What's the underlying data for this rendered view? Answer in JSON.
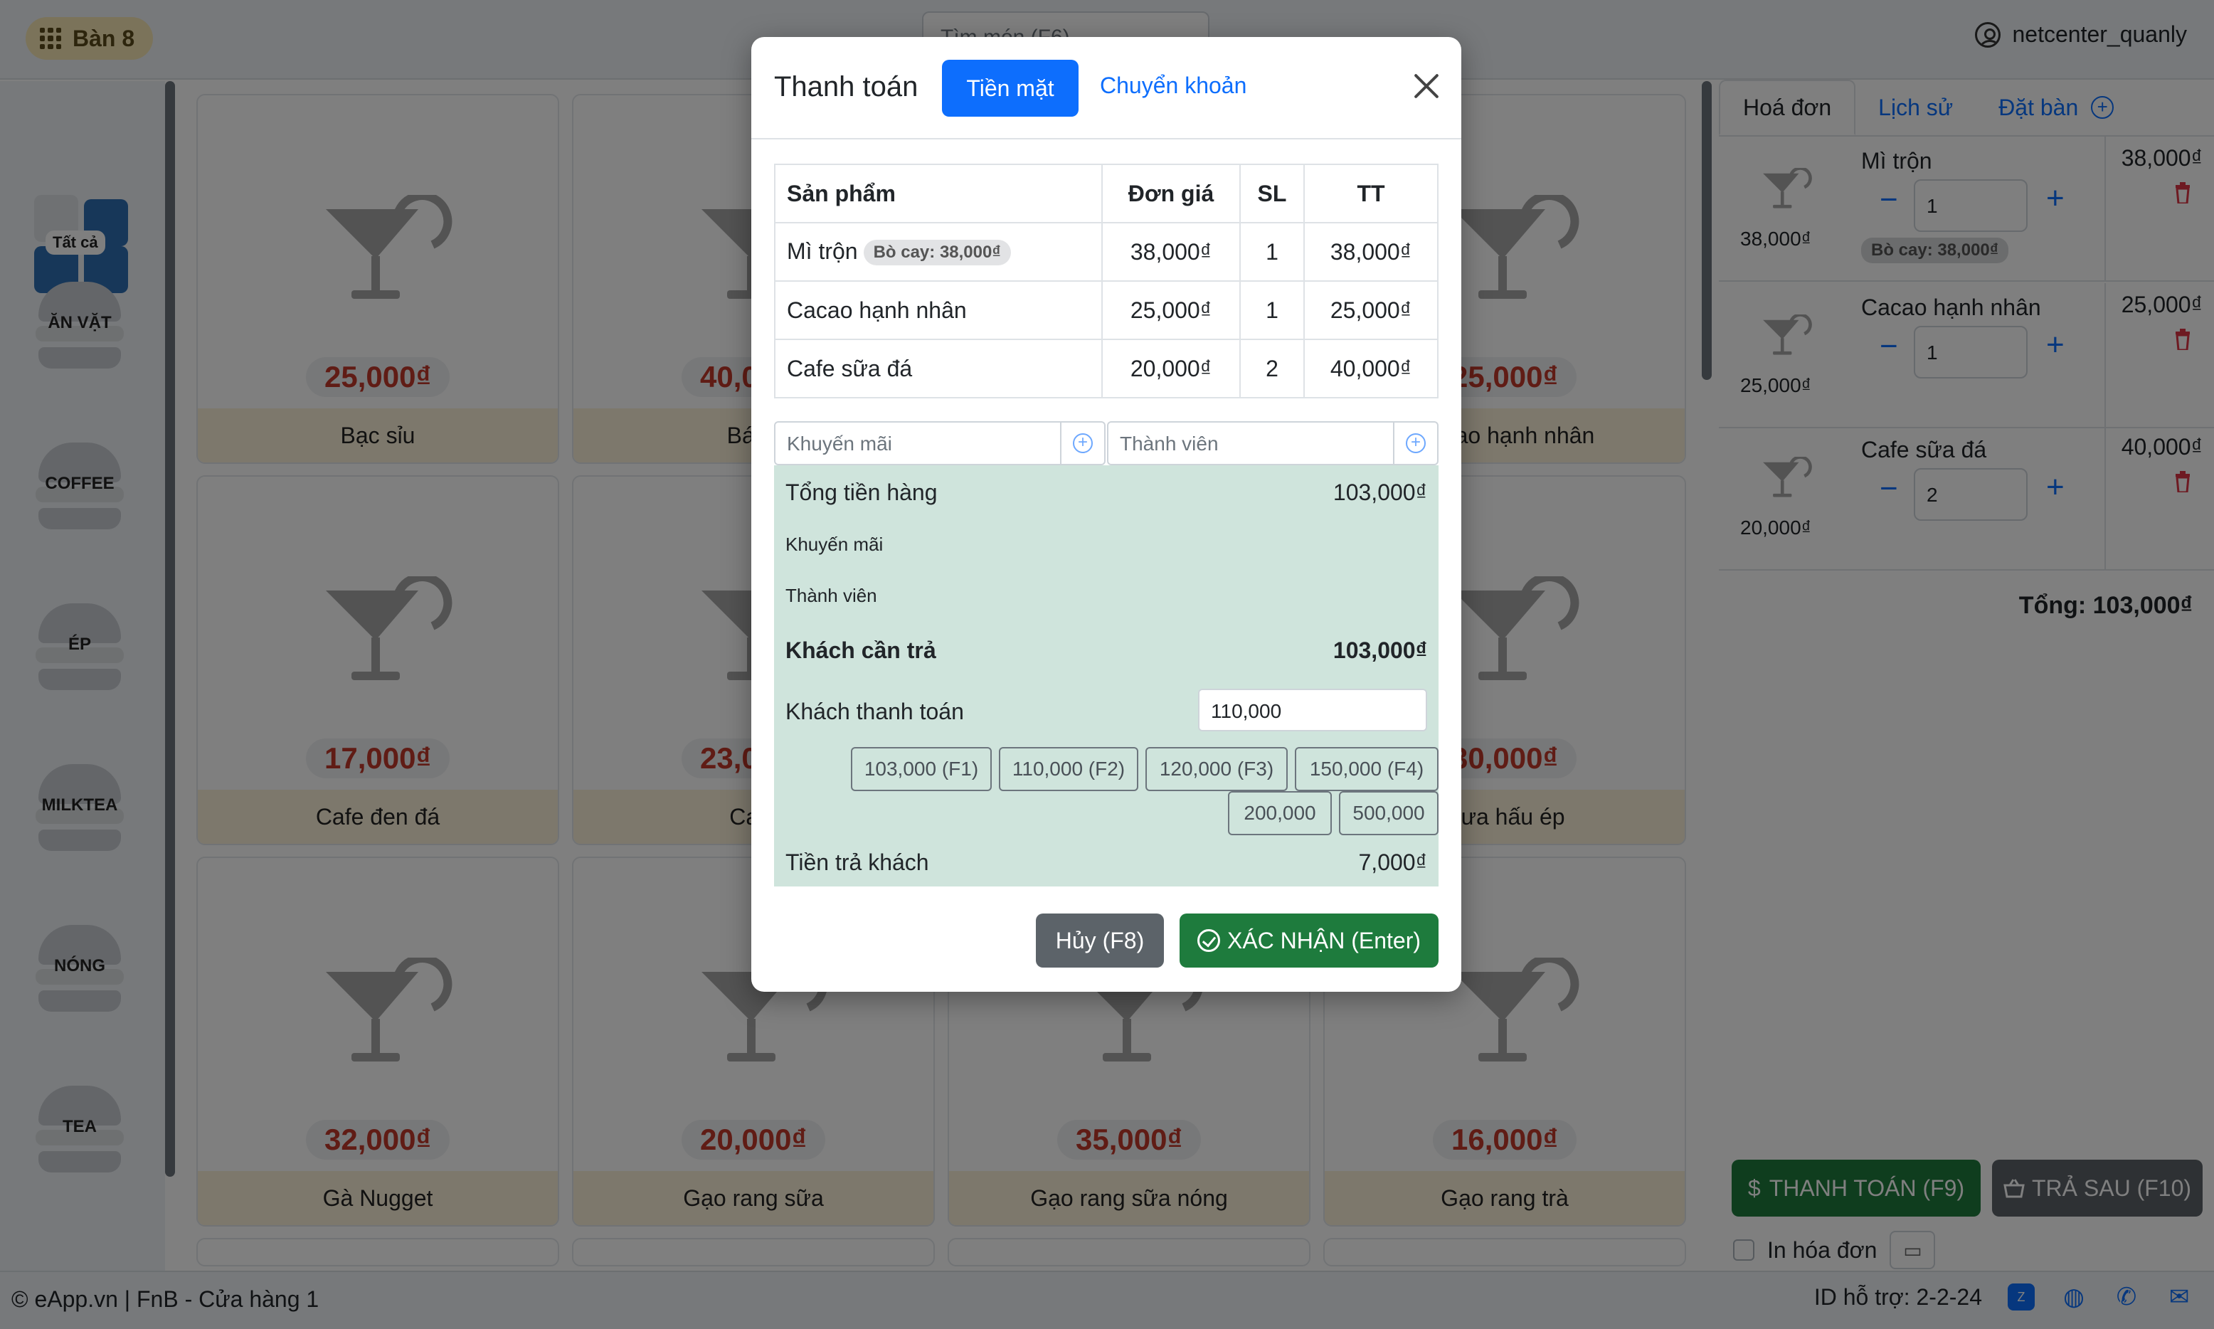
{
  "topbar": {
    "table_label": "Bàn 8",
    "search_placeholder": "Tìm món (F6)",
    "username": "netcenter_quanly"
  },
  "categories": [
    {
      "label": "Tất cả"
    },
    {
      "label": "ĂN VẶT"
    },
    {
      "label": "COFFEE"
    },
    {
      "label": "ÉP"
    },
    {
      "label": "MILKTEA"
    },
    {
      "label": "NÓNG"
    },
    {
      "label": "TEA"
    }
  ],
  "products": [
    {
      "price": "25,000₫",
      "name": "Bạc sỉu"
    },
    {
      "price": "40,000₫",
      "name": "Bánh"
    },
    {
      "price": "25,000₫",
      "name": ""
    },
    {
      "price": "25,000₫",
      "name": "Cacao hạnh nhân"
    },
    {
      "price": "17,000₫",
      "name": "Cafe đen đá"
    },
    {
      "price": "23,000₫",
      "name": "Cafe"
    },
    {
      "price": "",
      "name": ""
    },
    {
      "price": "30,000₫",
      "name": "Dưa hấu ép"
    },
    {
      "price": "32,000₫",
      "name": "Gà Nugget"
    },
    {
      "price": "20,000₫",
      "name": "Gạo rang sữa"
    },
    {
      "price": "35,000₫",
      "name": "Gạo rang sữa nóng"
    },
    {
      "price": "16,000₫",
      "name": "Gạo rang trà"
    }
  ],
  "right_panel": {
    "tabs": [
      "Hoá đơn",
      "Lịch sử",
      "Đặt bàn"
    ],
    "order_items": [
      {
        "name": "Mì trộn",
        "unit_price": "38,000₫",
        "qty": "1",
        "total": "38,000₫",
        "tag": "Bò cay: 38,000₫"
      },
      {
        "name": "Cacao hạnh nhân",
        "unit_price": "25,000₫",
        "qty": "1",
        "total": "25,000₫",
        "tag": ""
      },
      {
        "name": "Cafe sữa đá",
        "unit_price": "20,000₫",
        "qty": "2",
        "total": "40,000₫",
        "tag": ""
      }
    ],
    "total_label": "Tổng: 103,000₫",
    "pay_button": "THANH TOÁN (F9)",
    "pay_later_button": "TRẢ SAU (F10)",
    "print_label": "In hóa đơn"
  },
  "footer": {
    "left_text": "© eApp.vn | FnB - Cửa hàng 1",
    "support_id": "ID hỗ trợ: 2-2-24"
  },
  "modal": {
    "title": "Thanh toán",
    "tab_cash": "Tiền mặt",
    "tab_transfer": "Chuyển khoản",
    "table_headers": [
      "Sản phẩm",
      "Đơn giá",
      "SL",
      "TT"
    ],
    "rows": [
      {
        "name": "Mì trộn",
        "tag": "Bò cay: 38,000₫",
        "price": "38,000₫",
        "qty": "1",
        "total": "38,000₫"
      },
      {
        "name": "Cacao hạnh nhân",
        "tag": "",
        "price": "25,000₫",
        "qty": "1",
        "total": "25,000₫"
      },
      {
        "name": "Cafe sữa đá",
        "tag": "",
        "price": "20,000₫",
        "qty": "2",
        "total": "40,000₫"
      }
    ],
    "promo_placeholder": "Khuyến mãi",
    "member_placeholder": "Thành viên",
    "subtotal_label": "Tổng tiền hàng",
    "subtotal_value": "103,000₫",
    "promo_label": "Khuyến mãi",
    "member_label": "Thành viên",
    "due_label": "Khách cần trả",
    "due_value": "103,000₫",
    "paid_label": "Khách thanh toán",
    "paid_value": "110,000",
    "quick_amounts": [
      "103,000 (F1)",
      "110,000 (F2)",
      "120,000 (F3)",
      "150,000 (F4)",
      "200,000",
      "500,000"
    ],
    "change_label": "Tiền trả khách",
    "change_value": "7,000₫",
    "cancel_button": "Hủy (F8)",
    "confirm_button": "XÁC NHẬN (Enter)"
  }
}
